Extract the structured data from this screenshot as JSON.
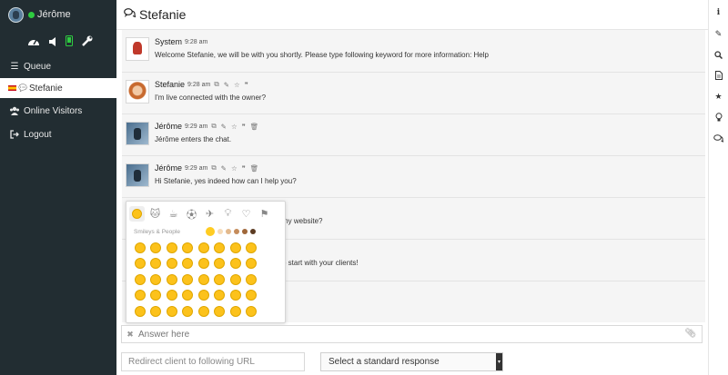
{
  "sidebar": {
    "user_name": "Jérôme",
    "toolbar_icons": [
      "dashboard-icon",
      "volume-icon",
      "mobile-icon",
      "wrench-icon"
    ],
    "items": [
      {
        "label": "Queue",
        "icon": "list-icon"
      },
      {
        "label": "Stefanie",
        "icon": "chat-icon",
        "flag": "es"
      },
      {
        "label": "Online Visitors",
        "icon": "users-icon"
      },
      {
        "label": "Logout",
        "icon": "logout-icon"
      }
    ]
  },
  "header": {
    "title": "Stefanie"
  },
  "messages": [
    {
      "author": "System",
      "time": "9:28 am",
      "text": "Welcome Stefanie, we will be with you shortly. Please type following keyword for more information: Help",
      "avatar": "system"
    },
    {
      "author": "Stefanie",
      "time": "9:28 am",
      "text": "I'm live connected with the owner?",
      "avatar": "stefanie"
    },
    {
      "author": "Jérôme",
      "time": "9:29 am",
      "text": "Jérôme enters the chat.",
      "avatar": "jerome"
    },
    {
      "author": "Jérôme",
      "time": "9:29 am",
      "text": "Hi Stefanie, yes indeed how can I help you?",
      "avatar": "jerome"
    }
  ],
  "partial_texts": [
    "my website?",
    "p start with your clients!"
  ],
  "emoji_picker": {
    "category_label": "Smileys & People",
    "categories": [
      "smileys",
      "animals",
      "food",
      "activity",
      "travel",
      "objects",
      "symbols",
      "flags"
    ],
    "tone_colors": [
      "#ffcc22",
      "#f6dbb8",
      "#e3b98c",
      "#c58c5b",
      "#a0673a",
      "#5c3b22"
    ]
  },
  "composer": {
    "answer_placeholder": "Answer here",
    "redirect_placeholder": "Redirect client to following URL",
    "standard_response": "Select a standard response"
  },
  "right_rail": [
    "info-icon",
    "edit-icon",
    "search-icon",
    "file-icon",
    "star-icon",
    "bulb-icon",
    "comments-icon"
  ],
  "colors": {
    "sidebar_bg": "#222d32",
    "online": "#2ecc40"
  }
}
